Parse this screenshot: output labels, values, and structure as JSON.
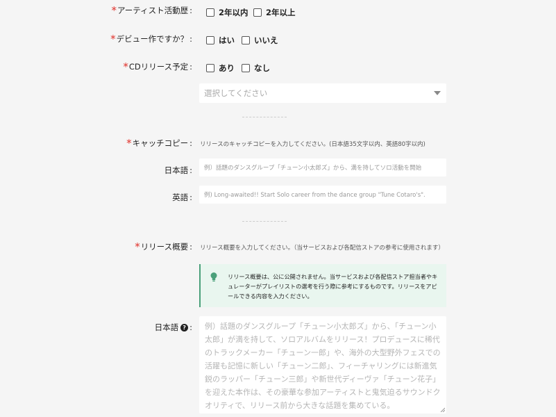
{
  "form": {
    "activity": {
      "label": "アーティスト活動歴",
      "options": [
        "2年以内",
        "2年以上"
      ]
    },
    "debut": {
      "label": "デビュー作ですか？",
      "options": [
        "はい",
        "いいえ"
      ]
    },
    "cd_release": {
      "label": "CDリリース予定",
      "options": [
        "あり",
        "なし"
      ],
      "select_placeholder": "選択してください"
    },
    "catchcopy": {
      "label": "キャッチコピー",
      "hint": "リリースのキャッチコピーを入力してください。(日本語35文字以内、英語80字以内)",
      "ja_label": "日本語",
      "ja_placeholder": "例）話題のダンスグループ「チューン小太郎ズ」から、満を持してソロ活動を開始",
      "en_label": "英語",
      "en_placeholder": "例) Long-awaited!! Start Solo career from the dance group \"Tune Cotaro's\"."
    },
    "summary": {
      "label": "リリース概要",
      "hint": "リリース概要を入力してください。（当サービスおよび各配信ストアの参考に使用されます）",
      "info": "リリース概要は、公に公開されません。当サービスおよび各配信ストア担当者やキュレーターがプレイリストの選考を行う際に参考にするものです。リリースをアピールできる内容を入力ください。",
      "ja_label": "日本語",
      "ja_placeholder": "例）話題のダンスグループ「チューン小太郎ズ」から、「チューン小太郎」が満を持して、ソロアルバムをリリース！プロデュースに稀代のトラックメーカー「チューン一郎」や、海外の大型野外フェスでの活躍も記憶に新しい「チューン二郎」、フィーチャリングには新進気鋭のラッパー「チューン三郎」や新世代ディーヴァ「チューン花子」を迎えた本作は、その豪華な参加アーティストと鬼気迫るサウンドクオリティで、リリース前から大きな話題を集めている。"
    }
  },
  "colors": {
    "required": "#e0302a",
    "info_bg": "#e9f6ef",
    "info_accent": "#4aa07a"
  },
  "icons": [
    "lightbulb-icon",
    "question-circle-icon",
    "chevron-down-icon",
    "resize-handle-icon"
  ]
}
